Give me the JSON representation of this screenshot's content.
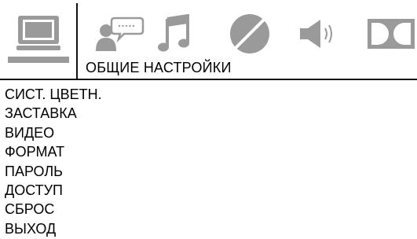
{
  "header": {
    "section_title": "ОБЩИЕ НАСТРОЙКИ"
  },
  "tabs": [
    {
      "icon": "monitor-icon",
      "active": true
    },
    {
      "icon": "person-speech-icon",
      "active": false
    },
    {
      "icon": "music-note-icon",
      "active": false
    },
    {
      "icon": "contrast-circle-icon",
      "active": false
    },
    {
      "icon": "speaker-icon",
      "active": false
    },
    {
      "icon": "dolby-icon",
      "active": false
    }
  ],
  "menu": {
    "items": [
      {
        "label": "СИСТ. ЦВЕТН."
      },
      {
        "label": "ЗАСТАВКА"
      },
      {
        "label": "ВИДЕО"
      },
      {
        "label": "ФОРМАТ"
      },
      {
        "label": "ПАРОЛЬ"
      },
      {
        "label": "ДОСТУП"
      },
      {
        "label": "СБРОС"
      },
      {
        "label": "ВЫХОД"
      }
    ]
  },
  "colors": {
    "icon_gray": "#9a9a9a",
    "line": "#111111",
    "background": "#ffffff"
  }
}
